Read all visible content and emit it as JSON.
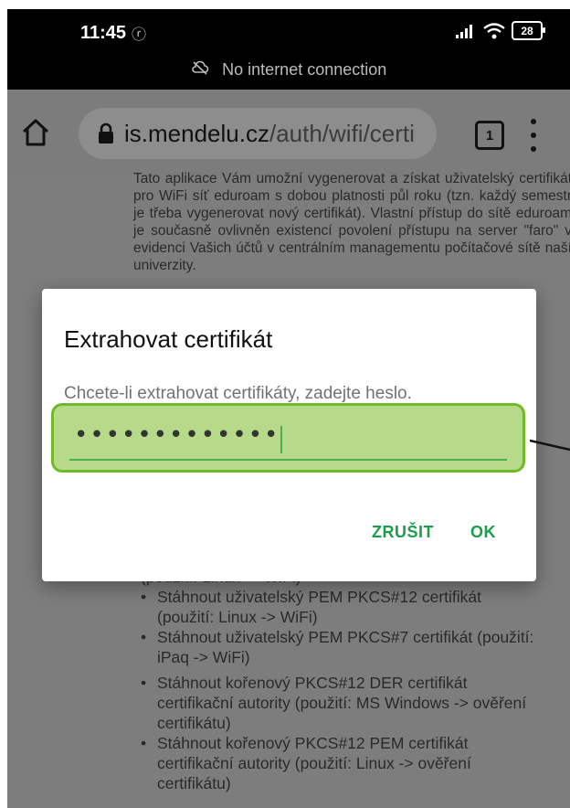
{
  "status_bar": {
    "time": "11:45",
    "battery": "28",
    "network_note": "No internet connection"
  },
  "browser": {
    "url_host": "is.mendelu.cz",
    "url_path": "/auth/wifi/certi",
    "tab_count": "1"
  },
  "page": {
    "intro_text": "Tato aplikace Vám umožní vygenerovat a získat uživatelský certifikát pro WiFi síť eduroam s dobou platnosti půl roku (tzn. každý semestr je třeba vygenerovat nový certifikát). Vlastní přístup do sítě eduroam je současně ovlivněn existencí povolení přístupu na server \"faro\" v evidenci Vašich účtů v centrálním managementu počítačové sítě naší univerzity.",
    "list": [
      "(použití: Linux -> WiFi)",
      "Stáhnout uživatelský PEM PKCS#12 certifikát (použití: Linux -> WiFi)",
      "Stáhnout uživatelský PEM PKCS#7 certifikát (použití: iPaq -> WiFi)",
      "Stáhnout kořenový PKCS#12 DER certifikát certifikační autority (použití: MS Windows -> ověření certifikátu)",
      "Stáhnout kořenový PKCS#12 PEM certifikát certifikační autority (použití: Linux -> ověření certifikátu)"
    ]
  },
  "dialog": {
    "title": "Extrahovat certifikát",
    "message": "Chcete-li extrahovat certifikáty, zadejte heslo.",
    "password_value": "•••••••••••••",
    "cancel_label": "ZRUŠIT",
    "ok_label": "OK"
  },
  "colors": {
    "accent": "#1b9e4b",
    "highlight_fill": "#b7d98a",
    "highlight_border": "#72b92a"
  }
}
